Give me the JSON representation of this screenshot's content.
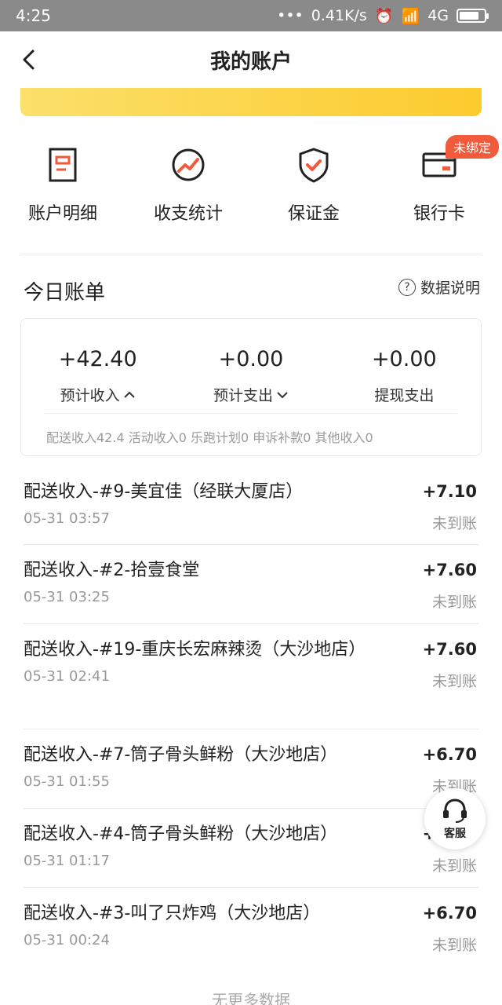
{
  "status_bar": {
    "time": "4:25",
    "dots": "•••",
    "speed": "0.41K/s",
    "network": "4G"
  },
  "header": {
    "title": "我的账户"
  },
  "quick_actions": [
    {
      "label": "账户明细",
      "icon": "document-icon"
    },
    {
      "label": "收支统计",
      "icon": "chart-circle-icon"
    },
    {
      "label": "保证金",
      "icon": "shield-icon"
    },
    {
      "label": "银行卡",
      "icon": "card-icon",
      "badge": "未绑定"
    }
  ],
  "today": {
    "title": "今日账单",
    "explain": "数据说明",
    "summary": [
      {
        "amount": "+42.40",
        "label": "预计收入"
      },
      {
        "amount": "+0.00",
        "label": "预计支出"
      },
      {
        "amount": "+0.00",
        "label": "提现支出"
      }
    ],
    "breakdown": "配送收入42.4 活动收入0 乐跑计划0 申诉补款0 其他收入0"
  },
  "transactions": [
    {
      "title": "配送收入-#9-美宜佳（经联大厦店）",
      "time": "05-31 03:57",
      "amount": "+7.10",
      "status": "未到账"
    },
    {
      "title": "配送收入-#2-拾壹食堂",
      "time": "05-31 03:25",
      "amount": "+7.60",
      "status": "未到账"
    },
    {
      "title": "配送收入-#19-重庆长宏麻辣烫（大沙地店）",
      "time": "05-31 02:41",
      "amount": "+7.60",
      "status": "未到账"
    },
    {
      "title": "配送收入-#7-筒子骨头鲜粉（大沙地店）",
      "time": "05-31 01:55",
      "amount": "+6.70",
      "status": "未到账"
    },
    {
      "title": "配送收入-#4-筒子骨头鲜粉（大沙地店）",
      "time": "05-31 01:17",
      "amount": "+6.70",
      "status": "未到账"
    },
    {
      "title": "配送收入-#3-叫了只炸鸡（大沙地店）",
      "time": "05-31 00:24",
      "amount": "+6.70",
      "status": "未到账"
    }
  ],
  "service_button": {
    "label": "客服"
  },
  "footer": {
    "no_more": "无更多数据"
  },
  "colors": {
    "accent_yellow": "#fccb2d",
    "icon_red": "#f15a3a",
    "badge_red": "#f15a3a"
  }
}
